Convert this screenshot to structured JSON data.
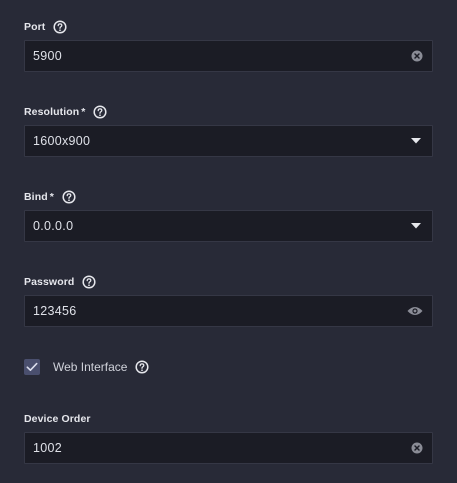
{
  "fields": {
    "port": {
      "label": "Port",
      "value": "5900",
      "trailing_icon": "clear-icon"
    },
    "resolution": {
      "label": "Resolution",
      "required_mark": "*",
      "value": "1600x900",
      "trailing_icon": "dropdown-arrow-icon"
    },
    "bind": {
      "label": "Bind",
      "required_mark": "*",
      "value": "0.0.0.0",
      "trailing_icon": "dropdown-arrow-icon"
    },
    "password": {
      "label": "Password",
      "value": "123456",
      "trailing_icon": "eye-icon"
    },
    "device_order": {
      "label": "Device Order",
      "value": "1002",
      "trailing_icon": "clear-icon"
    }
  },
  "web_interface": {
    "label": "Web Interface",
    "checked": true
  },
  "icons": {
    "help": "help-circle-icon",
    "checkbox": "checkmark-icon"
  },
  "colors": {
    "background": "#282a37",
    "input_background": "#1b1c25",
    "input_border": "#353745",
    "checkbox_fill": "#4a4f6e",
    "icon_gray": "#8a8c96"
  }
}
